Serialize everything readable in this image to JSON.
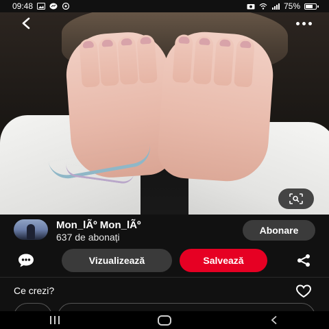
{
  "status_bar": {
    "time": "09:48",
    "battery": "75%",
    "battery_level": 0.75,
    "left_icons": [
      "image-icon",
      "messenger-icon",
      "whatsapp-icon"
    ],
    "right_icons": [
      "camera-icon",
      "wifi-icon",
      "signal-icon",
      "battery-icon"
    ]
  },
  "pin": {
    "user_name": "Mon_lÃº Mon_lÃº",
    "subscribers": "637 de abonați",
    "subscribe_label": "Abonare"
  },
  "actions": {
    "visit_label": "Vizualizează",
    "save_label": "Salvează"
  },
  "comments": {
    "title": "Ce crezi?"
  },
  "colors": {
    "background": "#111111",
    "save_button": "#e60023",
    "secondary_button": "#3a3a3a"
  },
  "icons": {
    "back": "back-arrow-icon",
    "more": "more-dots-icon",
    "lens": "visual-search-icon",
    "comment": "comment-bubble-icon",
    "share": "share-icon",
    "heart": "heart-icon"
  }
}
